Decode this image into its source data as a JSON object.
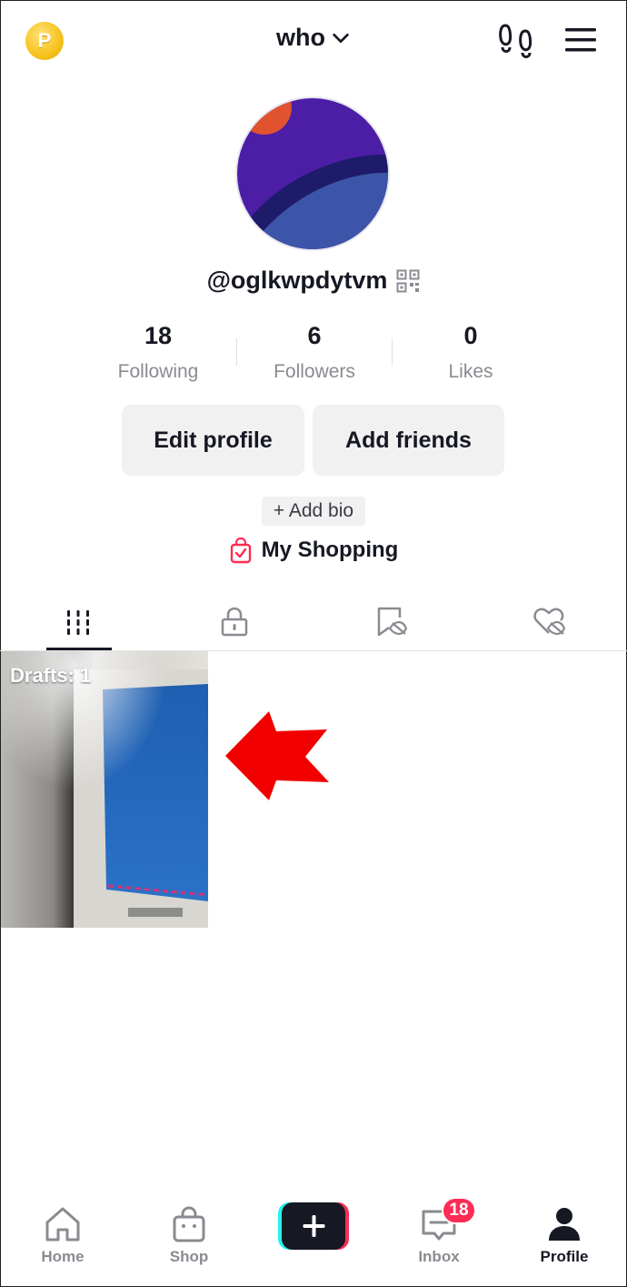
{
  "header": {
    "coin_letter": "P",
    "title": "who"
  },
  "profile": {
    "username": "@oglkwpdytvm",
    "stats": [
      {
        "value": "18",
        "label": "Following"
      },
      {
        "value": "6",
        "label": "Followers"
      },
      {
        "value": "0",
        "label": "Likes"
      }
    ],
    "edit_label": "Edit profile",
    "add_friends_label": "Add friends",
    "bio_label": "+ Add bio",
    "shopping_label": "My Shopping"
  },
  "tabs": [
    {
      "icon": "grid-icon",
      "active": true
    },
    {
      "icon": "lock-icon",
      "active": false
    },
    {
      "icon": "bookmark-eye-icon",
      "active": false
    },
    {
      "icon": "liked-hidden-icon",
      "active": false
    }
  ],
  "drafts": {
    "label": "Drafts: 1"
  },
  "nav": {
    "home": "Home",
    "shop": "Shop",
    "inbox": "Inbox",
    "inbox_badge": "18",
    "profile": "Profile"
  },
  "colors": {
    "accent": "#fe2c55",
    "coin": "#f6c21c",
    "arrow": "#f20000",
    "text": "#161823",
    "muted": "#8a8b91"
  }
}
